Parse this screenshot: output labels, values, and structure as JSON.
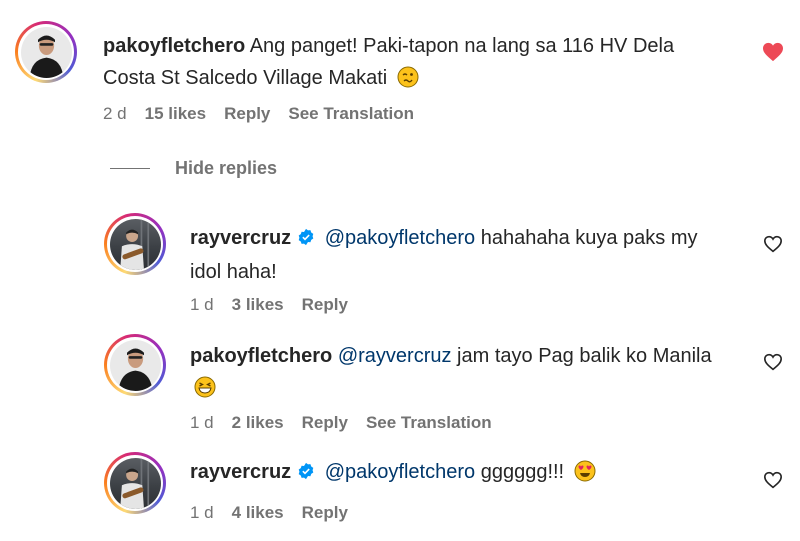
{
  "comments": [
    {
      "username": "pakoyfletchero",
      "text": "Ang panget! Paki-tapon na lang sa 116 HV Dela Costa St Salcedo Village Makati",
      "emoji": "woozy-face",
      "time": "2 d",
      "likes": "15 likes",
      "reply": "Reply",
      "translation": "See Translation",
      "liked": true
    },
    {
      "username": "rayvercruz",
      "verified": true,
      "mention": "@pakoyfletchero",
      "text": "hahahaha kuya paks my idol haha!",
      "time": "1 d",
      "likes": "3 likes",
      "reply": "Reply",
      "liked": false
    },
    {
      "username": "pakoyfletchero",
      "mention": "@rayvercruz",
      "text": "jam tayo Pag balik ko Manila",
      "emoji": "grinning-squinting-face",
      "time": "1 d",
      "likes": "2 likes",
      "reply": "Reply",
      "translation": "See Translation",
      "liked": false
    },
    {
      "username": "rayvercruz",
      "verified": true,
      "mention": "@pakoyfletchero",
      "text": "gggggg!!!",
      "emoji": "heart-eyes-face",
      "time": "1 d",
      "likes": "4 likes",
      "reply": "Reply",
      "liked": false
    }
  ],
  "hide_replies_label": "Hide replies",
  "colors": {
    "heart_active": "#ed4956",
    "mention": "#00376b",
    "verified": "#0095f6",
    "meta": "#737373"
  }
}
